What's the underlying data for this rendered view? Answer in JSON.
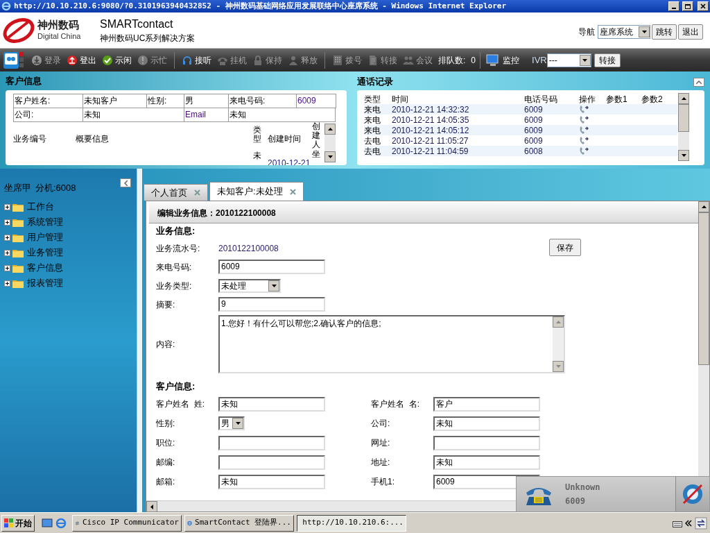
{
  "window": {
    "title": "http://10.10.210.6:9080/?0.3101963940432852 - 神州数码基础网络应用发展联络中心座席系统 - Windows Internet Explorer"
  },
  "header": {
    "brand_cn": "神州数码",
    "brand_en": "Digital China",
    "product": "SMARTcontact",
    "tagline": "神州数码UC系列解决方案",
    "nav_label": "导航",
    "nav_value": "座席系统",
    "buttons": [
      "跳转",
      "退出"
    ]
  },
  "toolbar": {
    "items": [
      {
        "label": "登录",
        "disabled": true
      },
      {
        "label": "登出",
        "disabled": false
      },
      {
        "label": "示闲",
        "disabled": false
      },
      {
        "label": "示忙",
        "disabled": true
      },
      {
        "label": "接听",
        "disabled": false
      },
      {
        "label": "挂机",
        "disabled": true
      },
      {
        "label": "保持",
        "disabled": true
      },
      {
        "label": "释放",
        "disabled": true
      },
      {
        "label": "拨号",
        "disabled": true
      },
      {
        "label": "转接",
        "disabled": true
      },
      {
        "label": "会议",
        "disabled": true
      }
    ],
    "queue_label": "排队数:",
    "queue_value": "0",
    "monitor": "监控",
    "ivr_label": "IVR",
    "ivr_value": "---",
    "ivr_button": "转接"
  },
  "customer_panel": {
    "title": "客户信息",
    "fields": [
      {
        "label": "客户姓名:",
        "value": "未知客户"
      },
      {
        "label": "性别:",
        "value": "男"
      },
      {
        "label": "来电号码:",
        "value": "6009"
      },
      {
        "label": "公司:",
        "value": "未知"
      },
      {
        "label": "Email",
        "value": "未知"
      }
    ],
    "columns": [
      "业务编号",
      "概要信息",
      "类型",
      "创建时间",
      "创建人坐"
    ],
    "row": [
      "未",
      "2010-12-21"
    ]
  },
  "call_log": {
    "title": "通话记录",
    "columns": [
      "类型",
      "时间",
      "电话号码",
      "操作",
      "参数1",
      "参数2"
    ],
    "rows": [
      {
        "type": "来电",
        "time": "2010-12-21 14:32:32",
        "number": "6009"
      },
      {
        "type": "来电",
        "time": "2010-12-21 14:05:35",
        "number": "6009"
      },
      {
        "type": "来电",
        "time": "2010-12-21 14:05:12",
        "number": "6009"
      },
      {
        "type": "去电",
        "time": "2010-12-21 11:05:27",
        "number": "6009"
      },
      {
        "type": "去电",
        "time": "2010-12-21 11:04:59",
        "number": "6008"
      }
    ]
  },
  "agent": {
    "name": "坐席甲",
    "extension_label": "分机:",
    "extension": "6008"
  },
  "tree": [
    {
      "label": "工作台",
      "expanded": false
    },
    {
      "label": "系统管理",
      "expanded": false
    },
    {
      "label": "用户管理",
      "expanded": false
    },
    {
      "label": "业务管理",
      "expanded": false
    },
    {
      "label": "客户信息",
      "expanded": false
    },
    {
      "label": "报表管理",
      "expanded": false
    }
  ],
  "tabs": [
    {
      "label": "个人首页",
      "selected": false
    },
    {
      "label": "未知客户:未处理",
      "selected": true
    }
  ],
  "form": {
    "title": "编辑业务信息：2010122100008",
    "save": "保存",
    "business_title": "业务信息:",
    "business": [
      {
        "kind": "text",
        "label": "业务流水号:",
        "value": "2010122100008"
      },
      {
        "kind": "input",
        "label": "来电号码:",
        "value": "6009"
      },
      {
        "kind": "select",
        "label": "业务类型:",
        "value": "未处理"
      },
      {
        "kind": "input",
        "label": "摘要:",
        "value": "9"
      },
      {
        "kind": "textarea",
        "label": "内容:",
        "value": "1.您好！有什么可以帮您;2.确认客户的信息;"
      }
    ],
    "customer_title": "客户信息:",
    "customer": [
      {
        "kind": "input",
        "label": "客户姓名  姓:",
        "value": "未知"
      },
      {
        "kind": "input",
        "label": "客户姓名  名:",
        "value": "客户"
      },
      {
        "kind": "select",
        "label": "性别:",
        "value": "男"
      },
      {
        "kind": "input",
        "label": "公司:",
        "value": "未知"
      },
      {
        "kind": "input",
        "label": "职位:"
      },
      {
        "kind": "input",
        "label": "网址:"
      },
      {
        "kind": "input",
        "label": "邮编:"
      },
      {
        "kind": "input",
        "label": "地址:",
        "value": "未知"
      },
      {
        "kind": "input",
        "label": "邮箱:",
        "value": "未知"
      },
      {
        "kind": "input",
        "label": "手机1:",
        "value": "6009"
      }
    ]
  },
  "phone_popup": {
    "name": "Unknown",
    "number": "6009"
  },
  "taskbar": {
    "start": "开始",
    "tasks": [
      {
        "label": "Cisco IP Communicator",
        "selected": false
      },
      {
        "label": "SmartContact 登陆界...",
        "selected": false
      },
      {
        "label": "http://10.10.210.6:...",
        "selected": true
      }
    ]
  }
}
